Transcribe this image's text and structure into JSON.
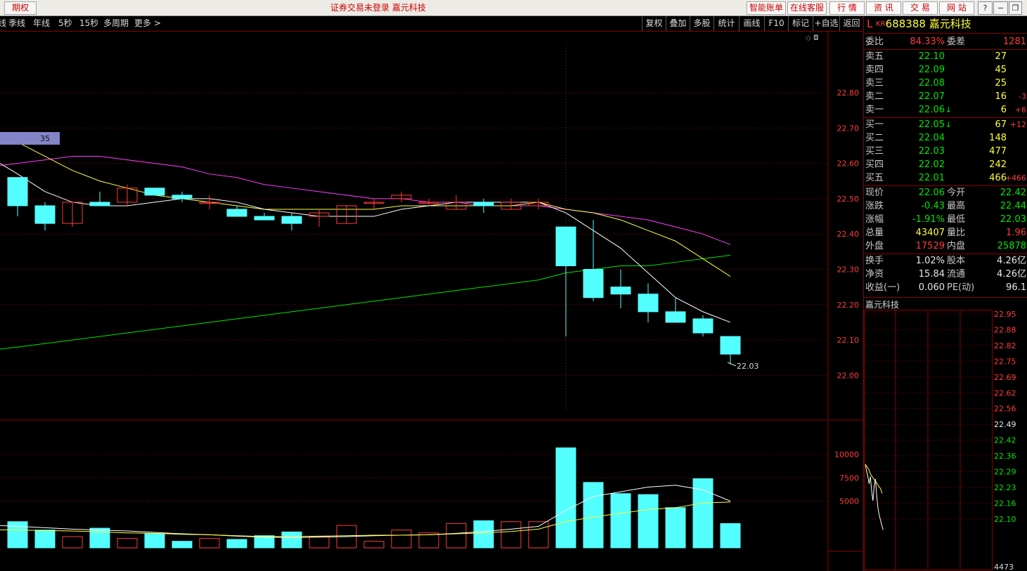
{
  "titlebar": {
    "period_tab": "期权",
    "center_text": "证券交易未登录  嘉元科技",
    "buttons": [
      "智能账单",
      "在线客服",
      "行  情",
      "资  讯",
      "交  易",
      "网  站"
    ],
    "window_controls": [
      "?",
      "−",
      "❐",
      "✕"
    ]
  },
  "toolbar": {
    "left_items": [
      "线",
      "季线",
      "年线",
      "5秒",
      "15秒",
      "多周期",
      "更多 >"
    ],
    "right_items": [
      "复权",
      "叠加",
      "多股",
      "统计",
      "画线",
      "F10",
      "标记",
      "+自选",
      "返回"
    ]
  },
  "main_chart": {
    "price_labels": [
      "22.80",
      "22.70",
      "22.60",
      "22.50",
      "22.40",
      "22.30",
      "22.20",
      "22.10",
      "22.00"
    ],
    "volume_labels": [
      "10000",
      "7500",
      "5000"
    ],
    "overlay_badge": "35",
    "low_annotation": "22.03",
    "colors": {
      "up": "#ff3c3c",
      "down": "#54ffff",
      "ma5": "#ffffff",
      "ma10": "#ffff3c",
      "ma20": "#ff3cff",
      "ma60": "#00e600",
      "grid": "#8b0000"
    }
  },
  "stock_header": {
    "prefix": "L",
    "market": "KR",
    "code": "688388",
    "name": "嘉元科技"
  },
  "order_ratio": {
    "label1": "委比",
    "ratio": "84.33%",
    "label2": "委差",
    "diff": "1281"
  },
  "asks": [
    {
      "label": "卖五",
      "price": "22.10",
      "vol": "27",
      "chg": "",
      "arrow": ""
    },
    {
      "label": "卖四",
      "price": "22.09",
      "vol": "45",
      "chg": "",
      "arrow": ""
    },
    {
      "label": "卖三",
      "price": "22.08",
      "vol": "25",
      "chg": "",
      "arrow": ""
    },
    {
      "label": "卖二",
      "price": "22.07",
      "vol": "16",
      "chg": "-3",
      "arrow": ""
    },
    {
      "label": "卖一",
      "price": "22.06",
      "vol": "6",
      "chg": "+6",
      "arrow": "↓"
    }
  ],
  "bids": [
    {
      "label": "买一",
      "price": "22.05",
      "vol": "67",
      "chg": "+12",
      "arrow": "↓"
    },
    {
      "label": "买二",
      "price": "22.04",
      "vol": "148",
      "chg": "",
      "arrow": ""
    },
    {
      "label": "买三",
      "price": "22.03",
      "vol": "477",
      "chg": "",
      "arrow": ""
    },
    {
      "label": "买四",
      "price": "22.02",
      "vol": "242",
      "chg": "",
      "arrow": ""
    },
    {
      "label": "买五",
      "price": "22.01",
      "vol": "466",
      "chg": "+466",
      "arrow": ""
    }
  ],
  "stats": [
    {
      "l1": "现价",
      "v1": "22.06",
      "c1": "green",
      "l2": "今开",
      "v2": "22.42",
      "c2": "green"
    },
    {
      "l1": "涨跌",
      "v1": "-0.43",
      "c1": "green",
      "l2": "最高",
      "v2": "22.44",
      "c2": "green"
    },
    {
      "l1": "涨幅",
      "v1": "-1.91%",
      "c1": "green",
      "l2": "最低",
      "v2": "22.03",
      "c2": "green"
    },
    {
      "l1": "总量",
      "v1": "43407",
      "c1": "yellow",
      "l2": "量比",
      "v2": "1.96",
      "c2": "red"
    },
    {
      "l1": "外盘",
      "v1": "17529",
      "c1": "red",
      "l2": "内盘",
      "v2": "25878",
      "c2": "green"
    }
  ],
  "fundamentals": [
    {
      "l1": "换手",
      "v1": "1.02%",
      "l2": "股本",
      "v2": "4.26亿"
    },
    {
      "l1": "净资",
      "v1": "15.84",
      "l2": "流通",
      "v2": "4.26亿"
    },
    {
      "l1": "收益(一)",
      "v1": "0.060",
      "l2": "PE(动)",
      "v2": "96.1"
    }
  ],
  "mini_chart": {
    "title": "嘉元科技",
    "price_labels": [
      "22.95",
      "22.88",
      "22.82",
      "22.75",
      "22.69",
      "22.62",
      "22.56",
      "22.49",
      "22.42",
      "22.36",
      "22.29",
      "22.23",
      "22.16",
      "22.10"
    ],
    "volume_label": "4473"
  },
  "chart_data": {
    "type": "candlestick",
    "ylim": [
      21.9,
      22.95
    ],
    "candles": [
      {
        "o": 22.56,
        "h": 22.56,
        "l": 22.45,
        "c": 22.48
      },
      {
        "o": 22.48,
        "h": 22.49,
        "l": 22.41,
        "c": 22.43
      },
      {
        "o": 22.43,
        "h": 22.49,
        "l": 22.42,
        "c": 22.49
      },
      {
        "o": 22.49,
        "h": 22.52,
        "l": 22.48,
        "c": 22.48
      },
      {
        "o": 22.49,
        "h": 22.54,
        "l": 22.48,
        "c": 22.53
      },
      {
        "o": 22.53,
        "h": 22.53,
        "l": 22.51,
        "c": 22.51
      },
      {
        "o": 22.51,
        "h": 22.52,
        "l": 22.49,
        "c": 22.5
      },
      {
        "o": 22.49,
        "h": 22.51,
        "l": 22.47,
        "c": 22.49
      },
      {
        "o": 22.47,
        "h": 22.48,
        "l": 22.45,
        "c": 22.45
      },
      {
        "o": 22.45,
        "h": 22.46,
        "l": 22.44,
        "c": 22.44
      },
      {
        "o": 22.45,
        "h": 22.46,
        "l": 22.41,
        "c": 22.43
      },
      {
        "o": 22.45,
        "h": 22.47,
        "l": 22.42,
        "c": 22.46
      },
      {
        "o": 22.43,
        "h": 22.48,
        "l": 22.43,
        "c": 22.48
      },
      {
        "o": 22.49,
        "h": 22.5,
        "l": 22.47,
        "c": 22.49
      },
      {
        "o": 22.5,
        "h": 22.52,
        "l": 22.49,
        "c": 22.51
      },
      {
        "o": 22.49,
        "h": 22.5,
        "l": 22.48,
        "c": 22.49
      },
      {
        "o": 22.47,
        "h": 22.51,
        "l": 22.47,
        "c": 22.49
      },
      {
        "o": 22.49,
        "h": 22.5,
        "l": 22.46,
        "c": 22.48
      },
      {
        "o": 22.47,
        "h": 22.5,
        "l": 22.47,
        "c": 22.49
      },
      {
        "o": 22.48,
        "h": 22.5,
        "l": 22.47,
        "c": 22.49
      },
      {
        "o": 22.42,
        "h": 22.42,
        "l": 22.11,
        "c": 22.31
      },
      {
        "o": 22.3,
        "h": 22.44,
        "l": 22.21,
        "c": 22.22
      },
      {
        "o": 22.25,
        "h": 22.3,
        "l": 22.19,
        "c": 22.23
      },
      {
        "o": 22.23,
        "h": 22.26,
        "l": 22.15,
        "c": 22.18
      },
      {
        "o": 22.18,
        "h": 22.22,
        "l": 22.15,
        "c": 22.15
      },
      {
        "o": 22.16,
        "h": 22.17,
        "l": 22.11,
        "c": 22.12
      },
      {
        "o": 22.11,
        "h": 22.11,
        "l": 22.03,
        "c": 22.06
      }
    ],
    "volumes": [
      2800,
      1900,
      1200,
      2100,
      1000,
      1500,
      700,
      1000,
      900,
      1300,
      1700,
      1200,
      2400,
      700,
      1900,
      1600,
      2600,
      2900,
      2800,
      2800,
      10700,
      7000,
      5800,
      5700,
      4300,
      7400,
      2600
    ],
    "ma5": [
      22.57,
      22.52,
      22.49,
      22.48,
      22.48,
      22.49,
      22.5,
      22.5,
      22.49,
      22.47,
      22.46,
      22.45,
      22.45,
      22.45,
      22.47,
      22.48,
      22.49,
      22.49,
      22.49,
      22.49,
      22.46,
      22.41,
      22.36,
      22.29,
      22.22,
      22.18,
      22.15
    ],
    "ma10": [
      22.66,
      22.62,
      22.58,
      22.55,
      22.53,
      22.51,
      22.5,
      22.49,
      22.48,
      22.47,
      22.47,
      22.47,
      22.47,
      22.47,
      22.48,
      22.48,
      22.48,
      22.48,
      22.48,
      22.49,
      22.47,
      22.46,
      22.44,
      22.41,
      22.38,
      22.33,
      22.28
    ],
    "ma20": [
      22.6,
      22.61,
      22.62,
      22.62,
      22.61,
      22.6,
      22.59,
      22.57,
      22.56,
      22.54,
      22.53,
      22.52,
      22.51,
      22.5,
      22.5,
      22.49,
      22.49,
      22.48,
      22.48,
      22.48,
      22.47,
      22.46,
      22.45,
      22.44,
      22.42,
      22.4,
      22.37
    ],
    "ma60": [
      22.08,
      22.09,
      22.1,
      22.11,
      22.12,
      22.13,
      22.14,
      22.15,
      22.16,
      22.17,
      22.18,
      22.19,
      22.2,
      22.21,
      22.22,
      22.23,
      22.24,
      22.25,
      22.26,
      22.27,
      22.29,
      22.3,
      22.31,
      22.31,
      22.32,
      22.33,
      22.34
    ],
    "vol_ma1": [
      2300,
      2150,
      2000,
      1900,
      1800,
      1650,
      1500,
      1400,
      1250,
      1150,
      1100,
      1150,
      1200,
      1300,
      1350,
      1400,
      1550,
      1750,
      2000,
      2300,
      4000,
      5500,
      6000,
      6500,
      6700,
      6200,
      5000
    ],
    "vol_ma2": [
      1900,
      1850,
      1800,
      1700,
      1600,
      1550,
      1450,
      1400,
      1300,
      1200,
      1200,
      1250,
      1300,
      1350,
      1350,
      1400,
      1500,
      1600,
      1750,
      2000,
      2800,
      3300,
      3700,
      4100,
      4300,
      4800,
      4900
    ],
    "mini_prices": [
      22.33,
      22.3,
      22.28,
      22.25,
      22.28,
      22.22,
      22.18,
      22.24,
      22.27,
      22.2,
      22.15,
      22.12,
      22.1,
      22.08,
      22.06
    ],
    "mini_avg": [
      22.33,
      22.32,
      22.31,
      22.29,
      22.28,
      22.27,
      22.26,
      22.25,
      22.24,
      22.23,
      22.21
    ]
  }
}
